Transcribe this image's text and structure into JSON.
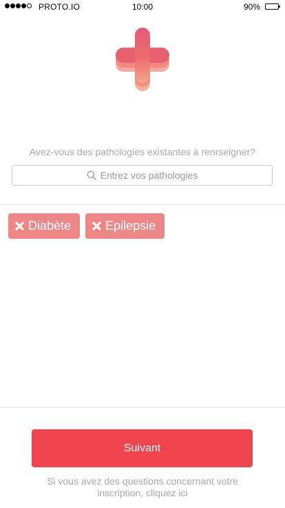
{
  "status_bar": {
    "carrier": "PROTO.IO",
    "time": "10:00",
    "battery": "90%",
    "signal_bars_filled": 4,
    "signal_bars_total": 5,
    "battery_level": 0.9
  },
  "logo": {
    "icon": "medical-cross-icon",
    "colors": [
      "#f5a79c",
      "#e8606f",
      "#f28f7a"
    ]
  },
  "prompt": "Avez-vous des pathologies existantes à renrseigner?",
  "search": {
    "placeholder": "Entrez vos pathologies",
    "icon": "search-icon"
  },
  "tags": [
    {
      "label": "Diabète",
      "remove_icon": "close-icon"
    },
    {
      "label": "Epilepsie",
      "remove_icon": "close-icon"
    }
  ],
  "next_button": {
    "label": "Suivant",
    "color": "#ee444d"
  },
  "help_text": "Si vous avez des questions concernant votre inscription, cliquez ici",
  "colors": {
    "tag": "#ee8686",
    "muted_text": "#a9a9a9"
  }
}
